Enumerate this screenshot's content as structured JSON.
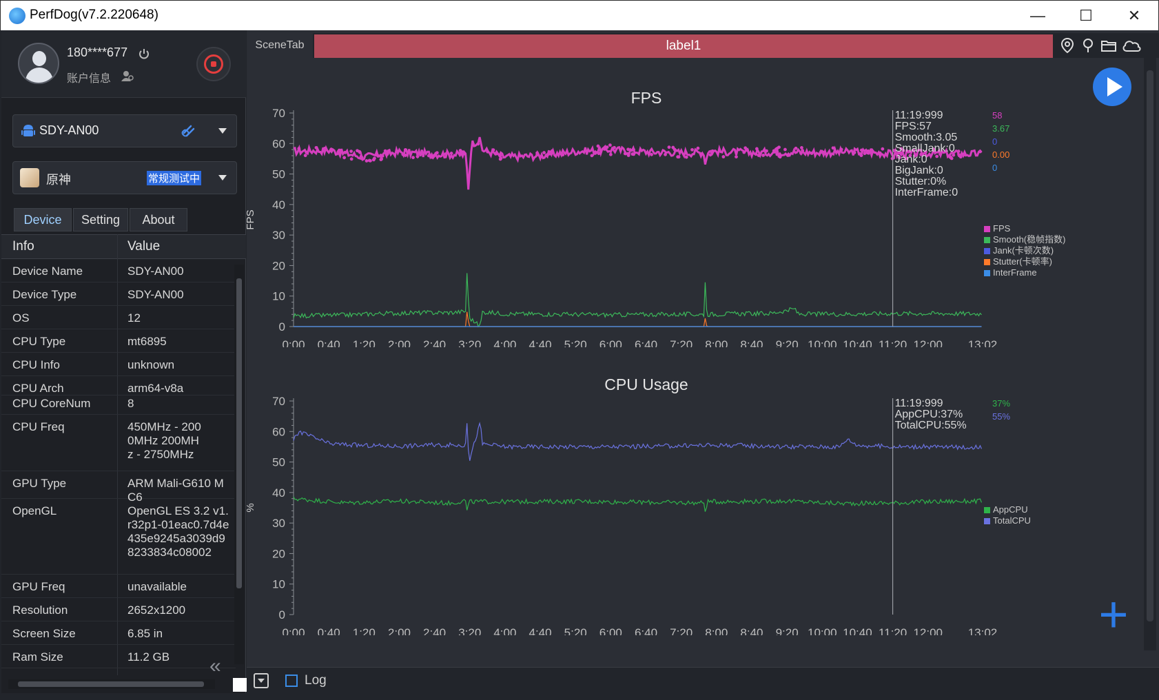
{
  "window": {
    "title": "PerfDog(v7.2.220648)",
    "minimize": "—",
    "maximize": "☐",
    "close": "✕"
  },
  "user": {
    "name": "180****677",
    "account": "账户信息"
  },
  "device": {
    "name": "SDY-AN00"
  },
  "app": {
    "name": "原神",
    "status": "常规测试中"
  },
  "tabs": [
    {
      "label": "Device"
    },
    {
      "label": "Setting"
    },
    {
      "label": "About"
    }
  ],
  "table": {
    "headers": [
      "Info",
      "Value"
    ],
    "rows": [
      {
        "k": "Device Name",
        "v": "SDY-AN00"
      },
      {
        "k": "Device Type",
        "v": "SDY-AN00"
      },
      {
        "k": "OS",
        "v": "12"
      },
      {
        "k": "CPU Type",
        "v": "mt6895"
      },
      {
        "k": "CPU Info",
        "v": "unknown"
      },
      {
        "k": "CPU Arch",
        "v": "arm64-v8a"
      },
      {
        "k": "CPU CoreNum",
        "v": "8"
      },
      {
        "k": "CPU Freq",
        "v": "450MHz - 2000MHz 200MHz - 2750MHz"
      },
      {
        "k": "GPU Type",
        "v": "ARM Mali-G610 MC6"
      },
      {
        "k": "OpenGL",
        "v": "OpenGL ES 3.2 v1.r32p1-01eac0.7d4e435e9245a3039d98233834c08002"
      },
      {
        "k": "GPU Freq",
        "v": "unavailable"
      },
      {
        "k": "Resolution",
        "v": "2652x1200"
      },
      {
        "k": "Screen Size",
        "v": "6.85 in"
      },
      {
        "k": "Ram Size",
        "v": "11.2 GB"
      }
    ]
  },
  "scene": {
    "tab": "SceneTab",
    "label": "label1"
  },
  "bottom": {
    "log": "Log"
  },
  "colors": {
    "fps": "#d63fbf",
    "smooth": "#3cb95a",
    "jank": "#4c5be0",
    "stutter": "#ff7a2a",
    "interframe": "#3b8de6",
    "app_cpu": "#2fb34a",
    "total_cpu": "#6a72e0",
    "accent": "#2d7be6",
    "label_bar": "#b34b5a"
  },
  "chart_data": [
    {
      "type": "line",
      "title": "FPS",
      "ylabel": "FPS",
      "ylim": [
        0,
        70
      ],
      "yticks": [
        0,
        10,
        20,
        30,
        40,
        50,
        60,
        70
      ],
      "xticks": [
        "0:00",
        "0:40",
        "1:20",
        "2:00",
        "2:40",
        "3:20",
        "4:00",
        "4:40",
        "5:20",
        "6:00",
        "6:40",
        "7:20",
        "8:00",
        "8:40",
        "9:20",
        "10:00",
        "10:40",
        "11:20",
        "12:00",
        "13:02"
      ],
      "xrange_seconds": [
        0,
        782
      ],
      "series": [
        {
          "name": "FPS",
          "baseline": 57,
          "points": [
            [
              0,
              57.5
            ],
            [
              40,
              57.8
            ],
            [
              80,
              55.6
            ],
            [
              120,
              57.2
            ],
            [
              160,
              56.5
            ],
            [
              196,
              56.3
            ],
            [
              198,
              44
            ],
            [
              200,
              52
            ],
            [
              202,
              60
            ],
            [
              212,
              61
            ],
            [
              214,
              58
            ],
            [
              240,
              55.6
            ],
            [
              280,
              56
            ],
            [
              320,
              57.4
            ],
            [
              360,
              58
            ],
            [
              400,
              57.3
            ],
            [
              440,
              57
            ],
            [
              466,
              57
            ],
            [
              467,
              53
            ],
            [
              470,
              57.5
            ],
            [
              520,
              57
            ],
            [
              560,
              57.2
            ],
            [
              600,
              57
            ],
            [
              640,
              57.3
            ],
            [
              680,
              56.6
            ],
            [
              720,
              56.8
            ],
            [
              760,
              56.6
            ],
            [
              782,
              56.6
            ]
          ]
        },
        {
          "name": "Smooth(稳帧指数)",
          "baseline": 3.5,
          "points": [
            [
              0,
              3.5
            ],
            [
              60,
              3.8
            ],
            [
              100,
              4.3
            ],
            [
              140,
              4.5
            ],
            [
              180,
              4.6
            ],
            [
              196,
              5
            ],
            [
              197,
              21
            ],
            [
              199,
              3
            ],
            [
              212,
              0
            ],
            [
              214,
              4.8
            ],
            [
              240,
              4.2
            ],
            [
              280,
              4.1
            ],
            [
              320,
              4
            ],
            [
              360,
              3.8
            ],
            [
              400,
              4
            ],
            [
              440,
              4
            ],
            [
              466,
              4
            ],
            [
              467,
              16
            ],
            [
              469,
              4
            ],
            [
              500,
              4.2
            ],
            [
              540,
              4.3
            ],
            [
              570,
              5.8
            ],
            [
              572,
              4.1
            ],
            [
              620,
              4.1
            ],
            [
              680,
              4.3
            ],
            [
              740,
              4.3
            ],
            [
              782,
              4.2
            ]
          ]
        },
        {
          "name": "Jank(卡顿次数)",
          "baseline": 0,
          "points": [
            [
              0,
              0
            ],
            [
              782,
              0
            ]
          ]
        },
        {
          "name": "Stutter(卡顿率)",
          "baseline": 0,
          "points": [
            [
              0,
              0
            ],
            [
              196,
              0
            ],
            [
              197,
              6
            ],
            [
              199,
              0
            ],
            [
              466,
              0
            ],
            [
              467,
              3
            ],
            [
              469,
              0
            ],
            [
              782,
              0
            ]
          ]
        },
        {
          "name": "InterFrame",
          "baseline": 0,
          "points": [
            [
              0,
              0
            ],
            [
              782,
              0
            ]
          ]
        }
      ],
      "cursor": {
        "time": "11:19:999",
        "lines": [
          "11:19:999",
          "FPS:57",
          "Smooth:3.05",
          "SmallJank:0",
          "Jank:0",
          "BigJank:0",
          "Stutter:0%",
          "InterFrame:0"
        ]
      },
      "right_values": [
        {
          "v": "58",
          "color": "#d63fbf"
        },
        {
          "v": "3.67",
          "color": "#3cb95a"
        },
        {
          "v": "0",
          "color": "#4c5be0"
        },
        {
          "v": "0.00",
          "color": "#ff7a2a"
        },
        {
          "v": "0",
          "color": "#3b8de6"
        }
      ]
    },
    {
      "type": "line",
      "title": "CPU Usage",
      "ylabel": "%",
      "ylim": [
        0,
        70
      ],
      "yticks": [
        0,
        10,
        20,
        30,
        40,
        50,
        60,
        70
      ],
      "xticks": [
        "0:00",
        "0:40",
        "1:20",
        "2:00",
        "2:40",
        "3:20",
        "4:00",
        "4:40",
        "5:20",
        "6:00",
        "6:40",
        "7:20",
        "8:00",
        "8:40",
        "9:20",
        "10:00",
        "10:40",
        "11:20",
        "12:00",
        "13:02"
      ],
      "xrange_seconds": [
        0,
        782
      ],
      "series": [
        {
          "name": "AppCPU",
          "baseline": 37,
          "points": [
            [
              0,
              38
            ],
            [
              60,
              36.6
            ],
            [
              120,
              37.2
            ],
            [
              180,
              36.5
            ],
            [
              196,
              37.5
            ],
            [
              197,
              33
            ],
            [
              199,
              37
            ],
            [
              240,
              37
            ],
            [
              320,
              37.1
            ],
            [
              400,
              36.8
            ],
            [
              466,
              36.6
            ],
            [
              467,
              34
            ],
            [
              470,
              37
            ],
            [
              560,
              37.2
            ],
            [
              620,
              36.4
            ],
            [
              680,
              36.6
            ],
            [
              720,
              37
            ],
            [
              782,
              37.2
            ]
          ]
        },
        {
          "name": "TotalCPU",
          "baseline": 55,
          "points": [
            [
              0,
              57
            ],
            [
              6,
              60
            ],
            [
              40,
              56
            ],
            [
              80,
              55.4
            ],
            [
              120,
              55.2
            ],
            [
              160,
              55.6
            ],
            [
              196,
              55.5
            ],
            [
              197,
              65
            ],
            [
              199,
              50
            ],
            [
              212,
              63
            ],
            [
              214,
              56
            ],
            [
              240,
              55
            ],
            [
              300,
              55
            ],
            [
              360,
              55
            ],
            [
              420,
              55.2
            ],
            [
              466,
              55.5
            ],
            [
              500,
              55.5
            ],
            [
              560,
              55
            ],
            [
              620,
              55
            ],
            [
              628,
              57.5
            ],
            [
              640,
              55.5
            ],
            [
              680,
              55
            ],
            [
              720,
              55
            ],
            [
              760,
              54.8
            ],
            [
              782,
              55
            ]
          ]
        }
      ],
      "cursor": {
        "time": "11:19:999",
        "lines": [
          "11:19:999",
          "AppCPU:37%",
          "TotalCPU:55%"
        ]
      },
      "right_values": [
        {
          "v": "37%",
          "color": "#2fb34a"
        },
        {
          "v": "55%",
          "color": "#6a72e0"
        }
      ]
    }
  ]
}
